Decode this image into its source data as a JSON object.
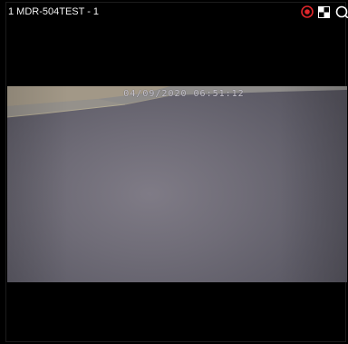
{
  "channel": {
    "title": "1 MDR-504TEST - 1"
  },
  "controls": {
    "record_icon": "record-icon",
    "layout_icon": "layout-grid-icon",
    "search_icon": "search-icon",
    "record_color": "#e0262b",
    "icon_color": "#ffffff"
  },
  "video": {
    "timestamp": "04/09/2020  06:51:12"
  }
}
